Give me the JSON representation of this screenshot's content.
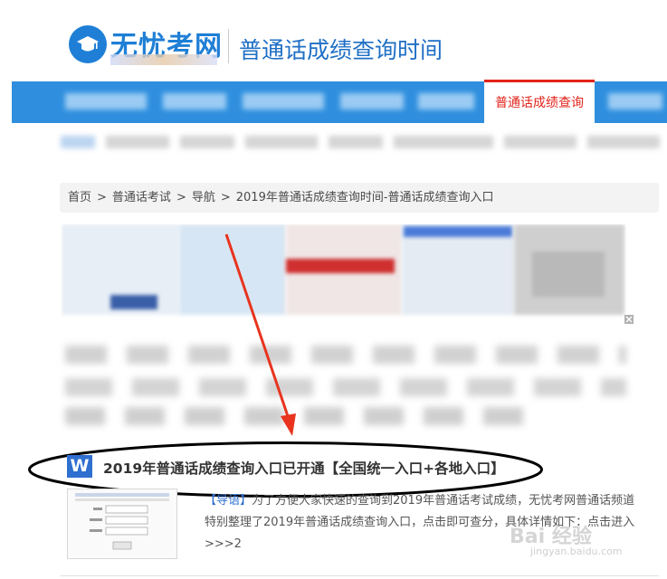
{
  "header": {
    "logo_text": "无忧考网",
    "site_title": "普通话成绩查询时间"
  },
  "nav": {
    "active_label": "普通话成绩查询"
  },
  "breadcrumb": {
    "items": [
      "首页",
      "普通话考试",
      "导航",
      "2019年普通话成绩查询时间-普通话成绩查询入口"
    ],
    "separator": ">"
  },
  "article": {
    "icon_letter": "W",
    "title": "2019年普通话成绩查询入口已开通【全国统一入口+各地入口】",
    "summary_tag": "【导语】",
    "summary_text": "为了方便大家快速的查询到2019年普通话考试成绩，无忧考网普通话频道特别整理了2019年普通话成绩查询入口，点击即可查分，具体详情如下：点击进入>>>2"
  },
  "watermark": {
    "text": "Bai 经验",
    "sub": "jingyan.baidu.com"
  },
  "colors": {
    "brand_blue": "#1f7fd6",
    "nav_blue": "#2f8fde",
    "accent_red": "#e2231a",
    "annotation_red": "#e8341f"
  }
}
